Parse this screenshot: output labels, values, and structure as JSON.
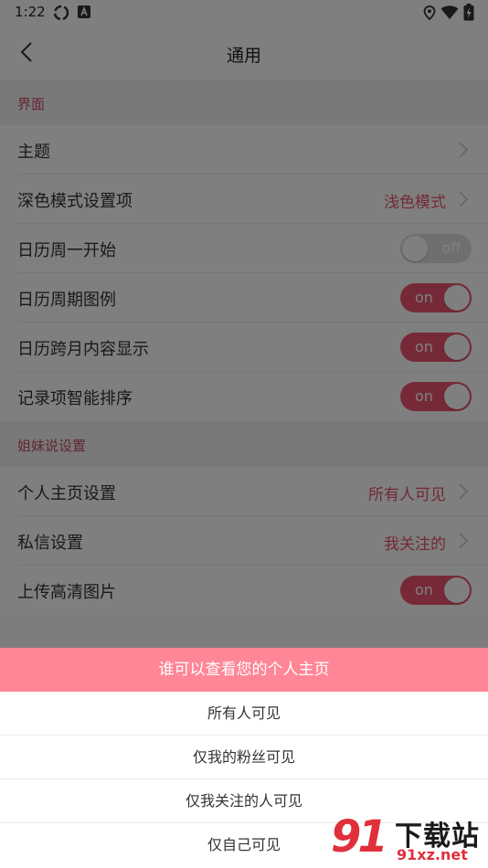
{
  "status_bar": {
    "time": "1:22"
  },
  "nav": {
    "title": "通用"
  },
  "sections": [
    {
      "header": "界面",
      "rows": [
        {
          "label": "主题",
          "type": "link",
          "value": ""
        },
        {
          "label": "深色模式设置项",
          "type": "link",
          "value": "浅色模式"
        },
        {
          "label": "日历周一开始",
          "type": "toggle",
          "state": "off",
          "text": "off"
        },
        {
          "label": "日历周期图例",
          "type": "toggle",
          "state": "on",
          "text": "on"
        },
        {
          "label": "日历跨月内容显示",
          "type": "toggle",
          "state": "on",
          "text": "on"
        },
        {
          "label": "记录项智能排序",
          "type": "toggle",
          "state": "on",
          "text": "on"
        }
      ]
    },
    {
      "header": "姐妹说设置",
      "rows": [
        {
          "label": "个人主页设置",
          "type": "link",
          "value": "所有人可见"
        },
        {
          "label": "私信设置",
          "type": "link",
          "value": "我关注的"
        },
        {
          "label": "上传高清图片",
          "type": "toggle",
          "state": "on",
          "text": "on"
        }
      ]
    }
  ],
  "sheet": {
    "title": "谁可以查看您的个人主页",
    "options": [
      "所有人可见",
      "仅我的粉丝可见",
      "仅我关注的人可见",
      "仅自己可见"
    ]
  },
  "watermark": {
    "logo": "91",
    "name": "下载站",
    "url": "91xz.net"
  },
  "colors": {
    "accent": "#ec5470",
    "sheet_header": "#ff8696",
    "section_text": "#c84a66"
  }
}
